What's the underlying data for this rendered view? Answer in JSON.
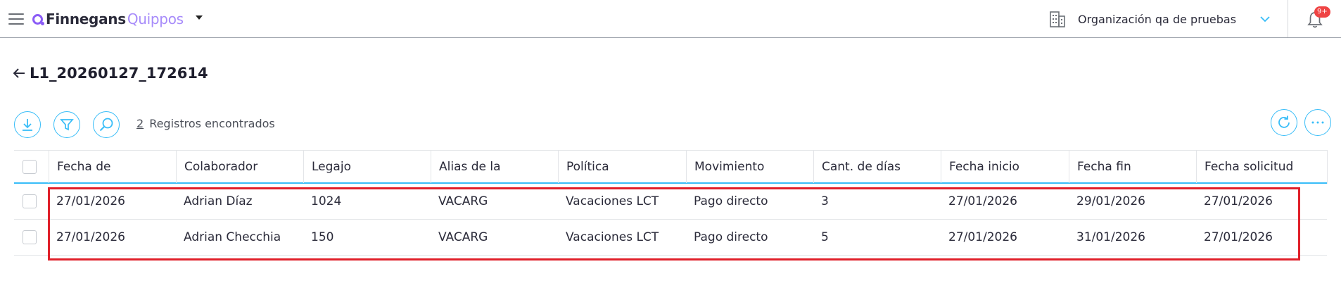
{
  "header": {
    "logo_word1": "Finnegans",
    "logo_word2": "Quippos",
    "organization": "Organización qa de pruebas",
    "notifications_badge": "9+"
  },
  "page": {
    "title": "L1_20260127_172614"
  },
  "toolbar": {
    "records_count": "2",
    "records_label": "Registros encontrados"
  },
  "table": {
    "columns": [
      "Fecha de",
      "Colaborador",
      "Legajo",
      "Alias de la",
      "Política",
      "Movimiento",
      "Cant. de días",
      "Fecha inicio",
      "Fecha fin",
      "Fecha solicitud"
    ],
    "rows": [
      [
        "27/01/2026",
        "Adrian Díaz",
        "1024",
        "VACARG",
        "Vacaciones LCT",
        "Pago directo",
        "3",
        "27/01/2026",
        "29/01/2026",
        "27/01/2026"
      ],
      [
        "27/01/2026",
        "Adrian Checchia",
        "150",
        "VACARG",
        "Vacaciones LCT",
        "Pago directo",
        "5",
        "27/01/2026",
        "31/01/2026",
        "27/01/2026"
      ]
    ]
  },
  "colors": {
    "accent": "#38bdf8",
    "brand": "#8b5cf6",
    "highlight": "#e0202a",
    "badge": "#ef4444"
  },
  "icons": [
    "menu-icon",
    "caret-down-icon",
    "building-icon",
    "chevron-down-icon",
    "bell-icon",
    "back-arrow-icon",
    "download-icon",
    "filter-icon",
    "search-icon",
    "refresh-icon",
    "more-icon"
  ]
}
